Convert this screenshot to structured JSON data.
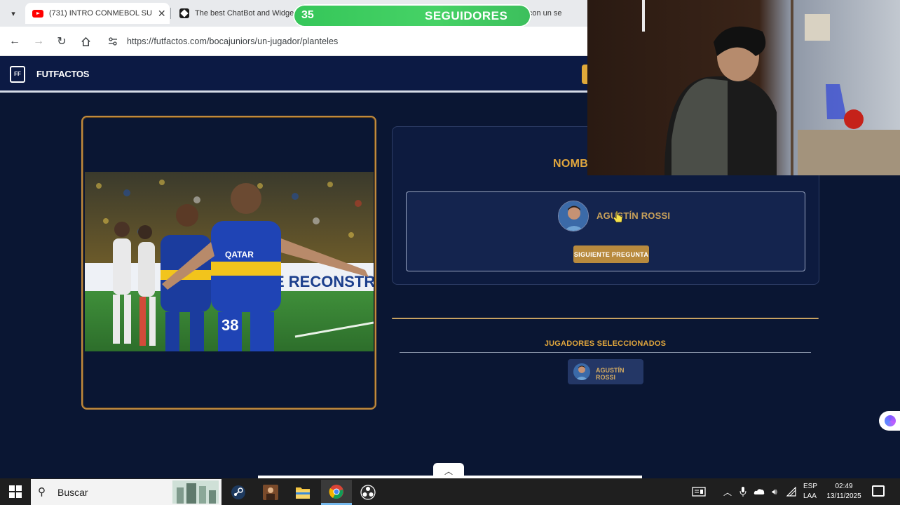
{
  "browser": {
    "tabs": [
      {
        "title": "(731) INTRO CONMEBOL SU",
        "icon": "youtube-icon",
        "active": true
      },
      {
        "title": "The best ChatBot and Widge",
        "icon": "chatbot-icon",
        "active": false
      },
      {
        "title": "noja con un se",
        "icon": "",
        "active": false
      }
    ],
    "url": "https://futfactos.com/bocajuniors/un-jugador/planteles"
  },
  "overlay": {
    "followers_count": "35",
    "followers_label": "SEGUIDORES"
  },
  "site": {
    "logo_mark": "FF",
    "logo_text": "FUTFACTOS",
    "accent_color": "#e2a73d",
    "background_color": "#0a1633"
  },
  "quiz": {
    "question_title": "NOMBRA",
    "answer_name": "AGUSTÍN ROSSI",
    "next_button": "SIGUIENTE PREGUNTA"
  },
  "selected": {
    "title": "JUGADORES SELECCIONADOS",
    "players": [
      {
        "name": "AGUSTÍN ROSSI"
      }
    ]
  },
  "taskbar": {
    "search_placeholder": "Buscar",
    "apps": [
      "steam-icon",
      "photo-app-icon",
      "file-explorer-icon",
      "chrome-icon",
      "obs-icon"
    ],
    "language_line1": "ESP",
    "language_line2": "LAA",
    "time": "02:49",
    "date": "13/11/2025"
  }
}
